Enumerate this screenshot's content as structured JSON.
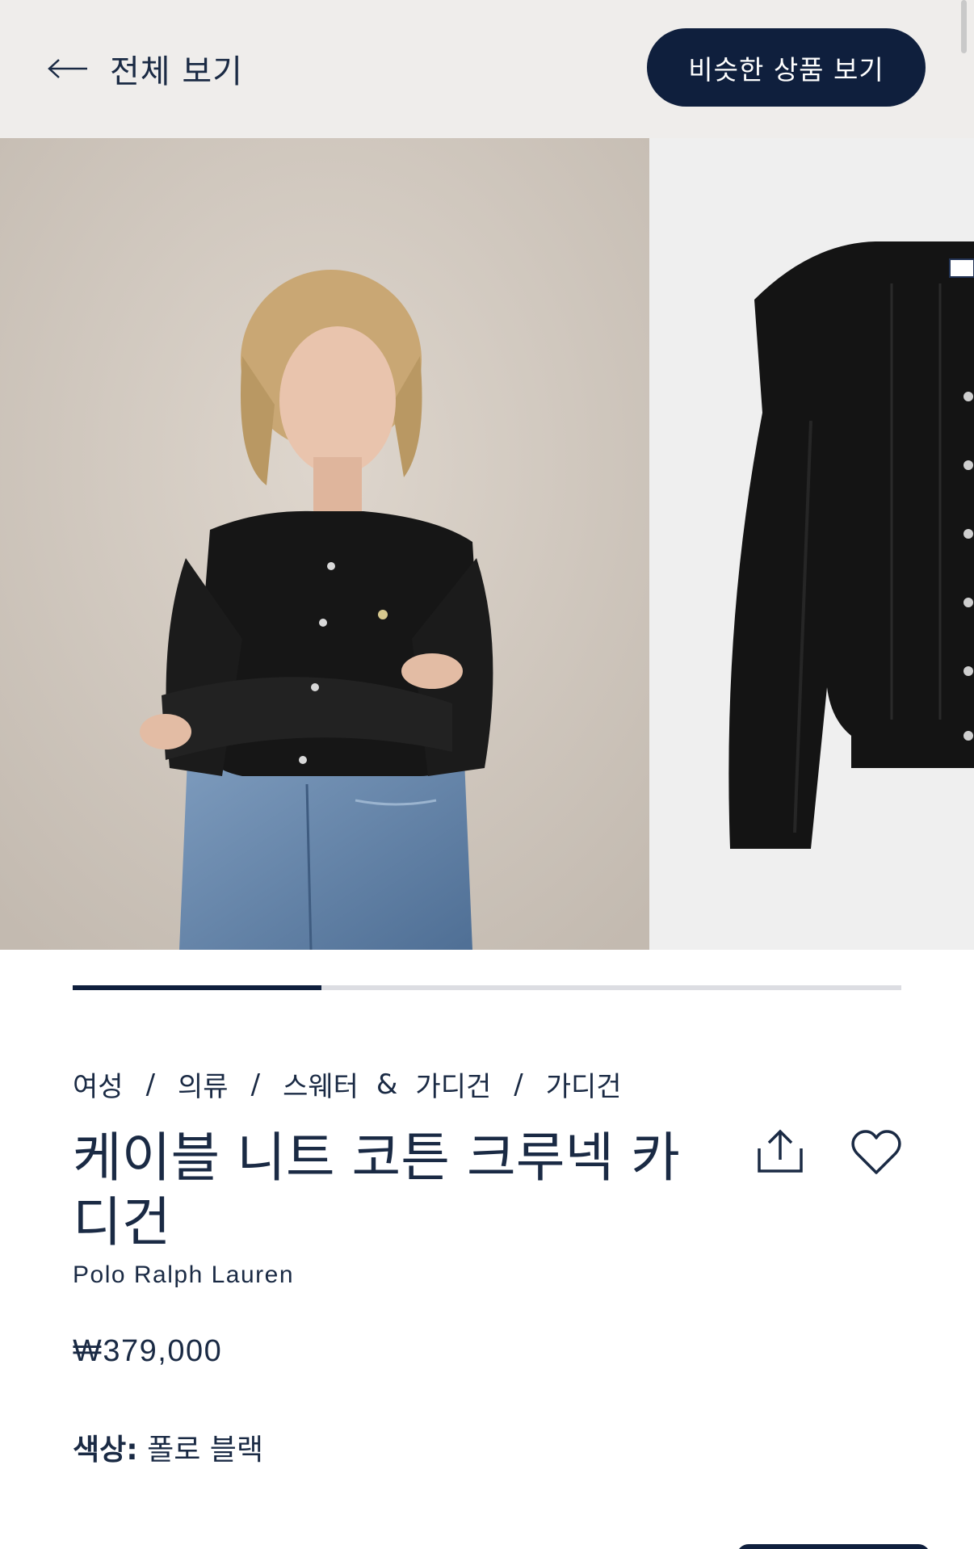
{
  "header": {
    "back_label": "전체 보기",
    "similar_button": "비슷한 상품 보기"
  },
  "gallery": {
    "images": [
      {
        "description_icon": "model-photo"
      },
      {
        "description_icon": "product-photo"
      }
    ],
    "progress_fraction": 0.3
  },
  "breadcrumb": {
    "items": [
      "여성",
      "의류",
      "스웨터",
      "가디건",
      "가디건"
    ],
    "separators": [
      "/",
      "/",
      "&",
      "/"
    ]
  },
  "product": {
    "title": "케이블 니트 코튼 크루넥 카디건",
    "brand": "Polo Ralph Lauren",
    "price": "₩379,000",
    "color_label": "색상:",
    "color_value": "폴로 블랙"
  },
  "icons": {
    "back": "arrow-left-icon",
    "share": "share-icon",
    "favorite": "heart-icon"
  },
  "colors": {
    "navy": "#0f1f3d",
    "topbar_bg": "#efedeb",
    "text": "#1a2a44"
  }
}
